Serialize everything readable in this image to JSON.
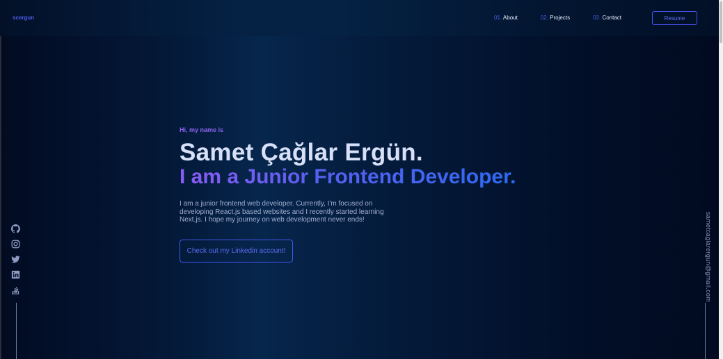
{
  "nav": {
    "logo": "scergun",
    "links": [
      {
        "num": "01.",
        "label": "About"
      },
      {
        "num": "02.",
        "label": "Projects"
      },
      {
        "num": "03.",
        "label": "Contact"
      }
    ],
    "resume": "Resume"
  },
  "hero": {
    "greeting": "Hi, my name is",
    "name": "Samet Çağlar Ergün.",
    "role": "I am a Junior Frontend Developer.",
    "description": "I am a junior frontend web developer. Currently, I'm focused on developing React.js based websites and I recently started learning Next.js. I hope my journey on web development never ends!",
    "cta": "Check out my Linkedin account!"
  },
  "social": [
    "github-icon",
    "instagram-icon",
    "twitter-icon",
    "linkedin-icon",
    "stackoverflow-icon"
  ],
  "email": "sametcaglarergun@gmail.com",
  "colors": {
    "accent": "#4a5be8",
    "purple": "#8b5cf6",
    "text": "#ccd6f6"
  }
}
